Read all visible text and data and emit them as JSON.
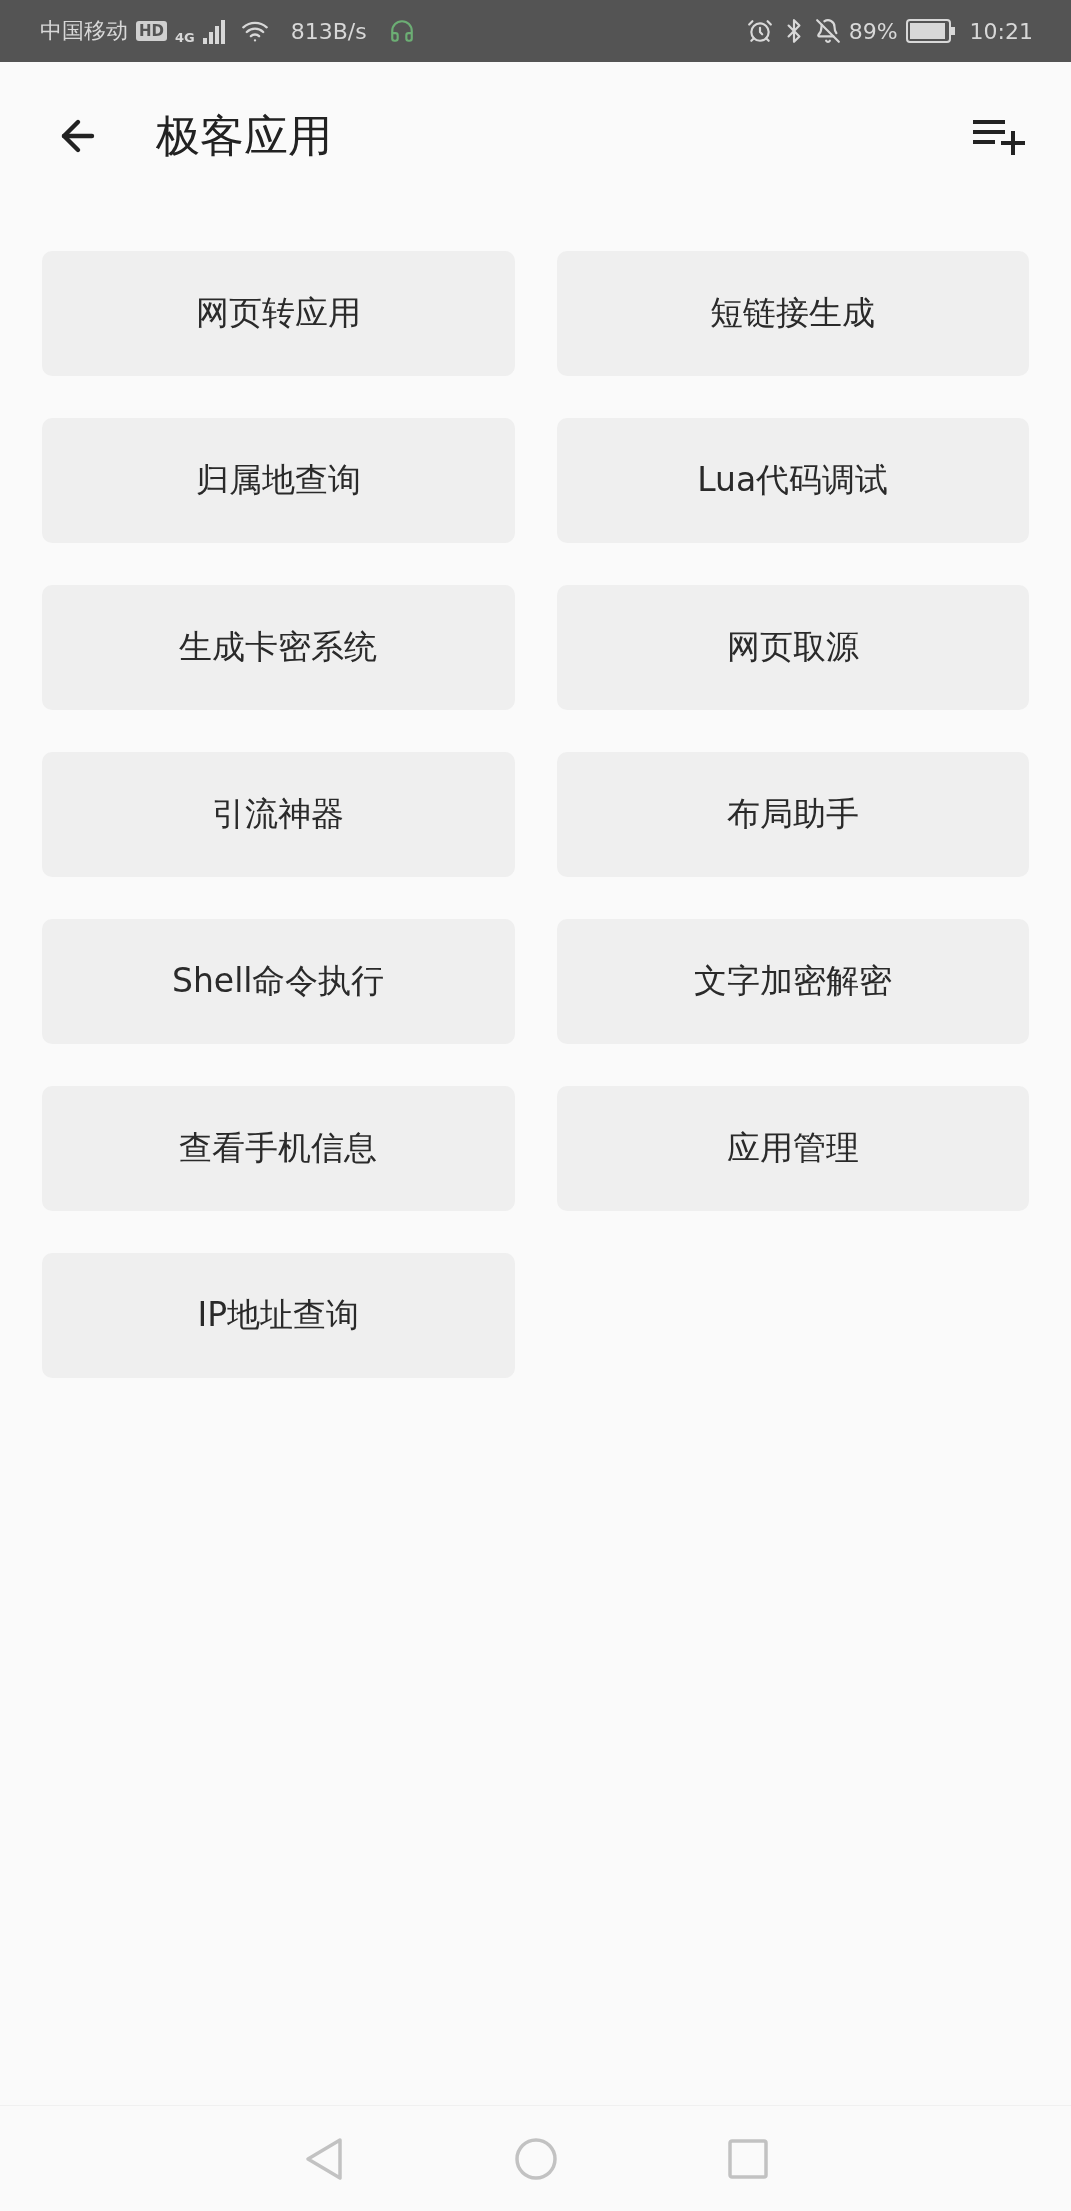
{
  "status_bar": {
    "carrier": "中国移动",
    "hd_badge": "HD",
    "network": "4G",
    "speed": "813B/s",
    "battery": "89%",
    "time": "10:21"
  },
  "header": {
    "title": "极客应用"
  },
  "apps": [
    {
      "label": "网页转应用"
    },
    {
      "label": "短链接生成"
    },
    {
      "label": "归属地查询"
    },
    {
      "label": "Lua代码调试"
    },
    {
      "label": "生成卡密系统"
    },
    {
      "label": "网页取源"
    },
    {
      "label": "引流神器"
    },
    {
      "label": "布局助手"
    },
    {
      "label": "Shell命令执行"
    },
    {
      "label": "文字加密解密"
    },
    {
      "label": "查看手机信息"
    },
    {
      "label": "应用管理"
    },
    {
      "label": "IP地址查询"
    }
  ]
}
